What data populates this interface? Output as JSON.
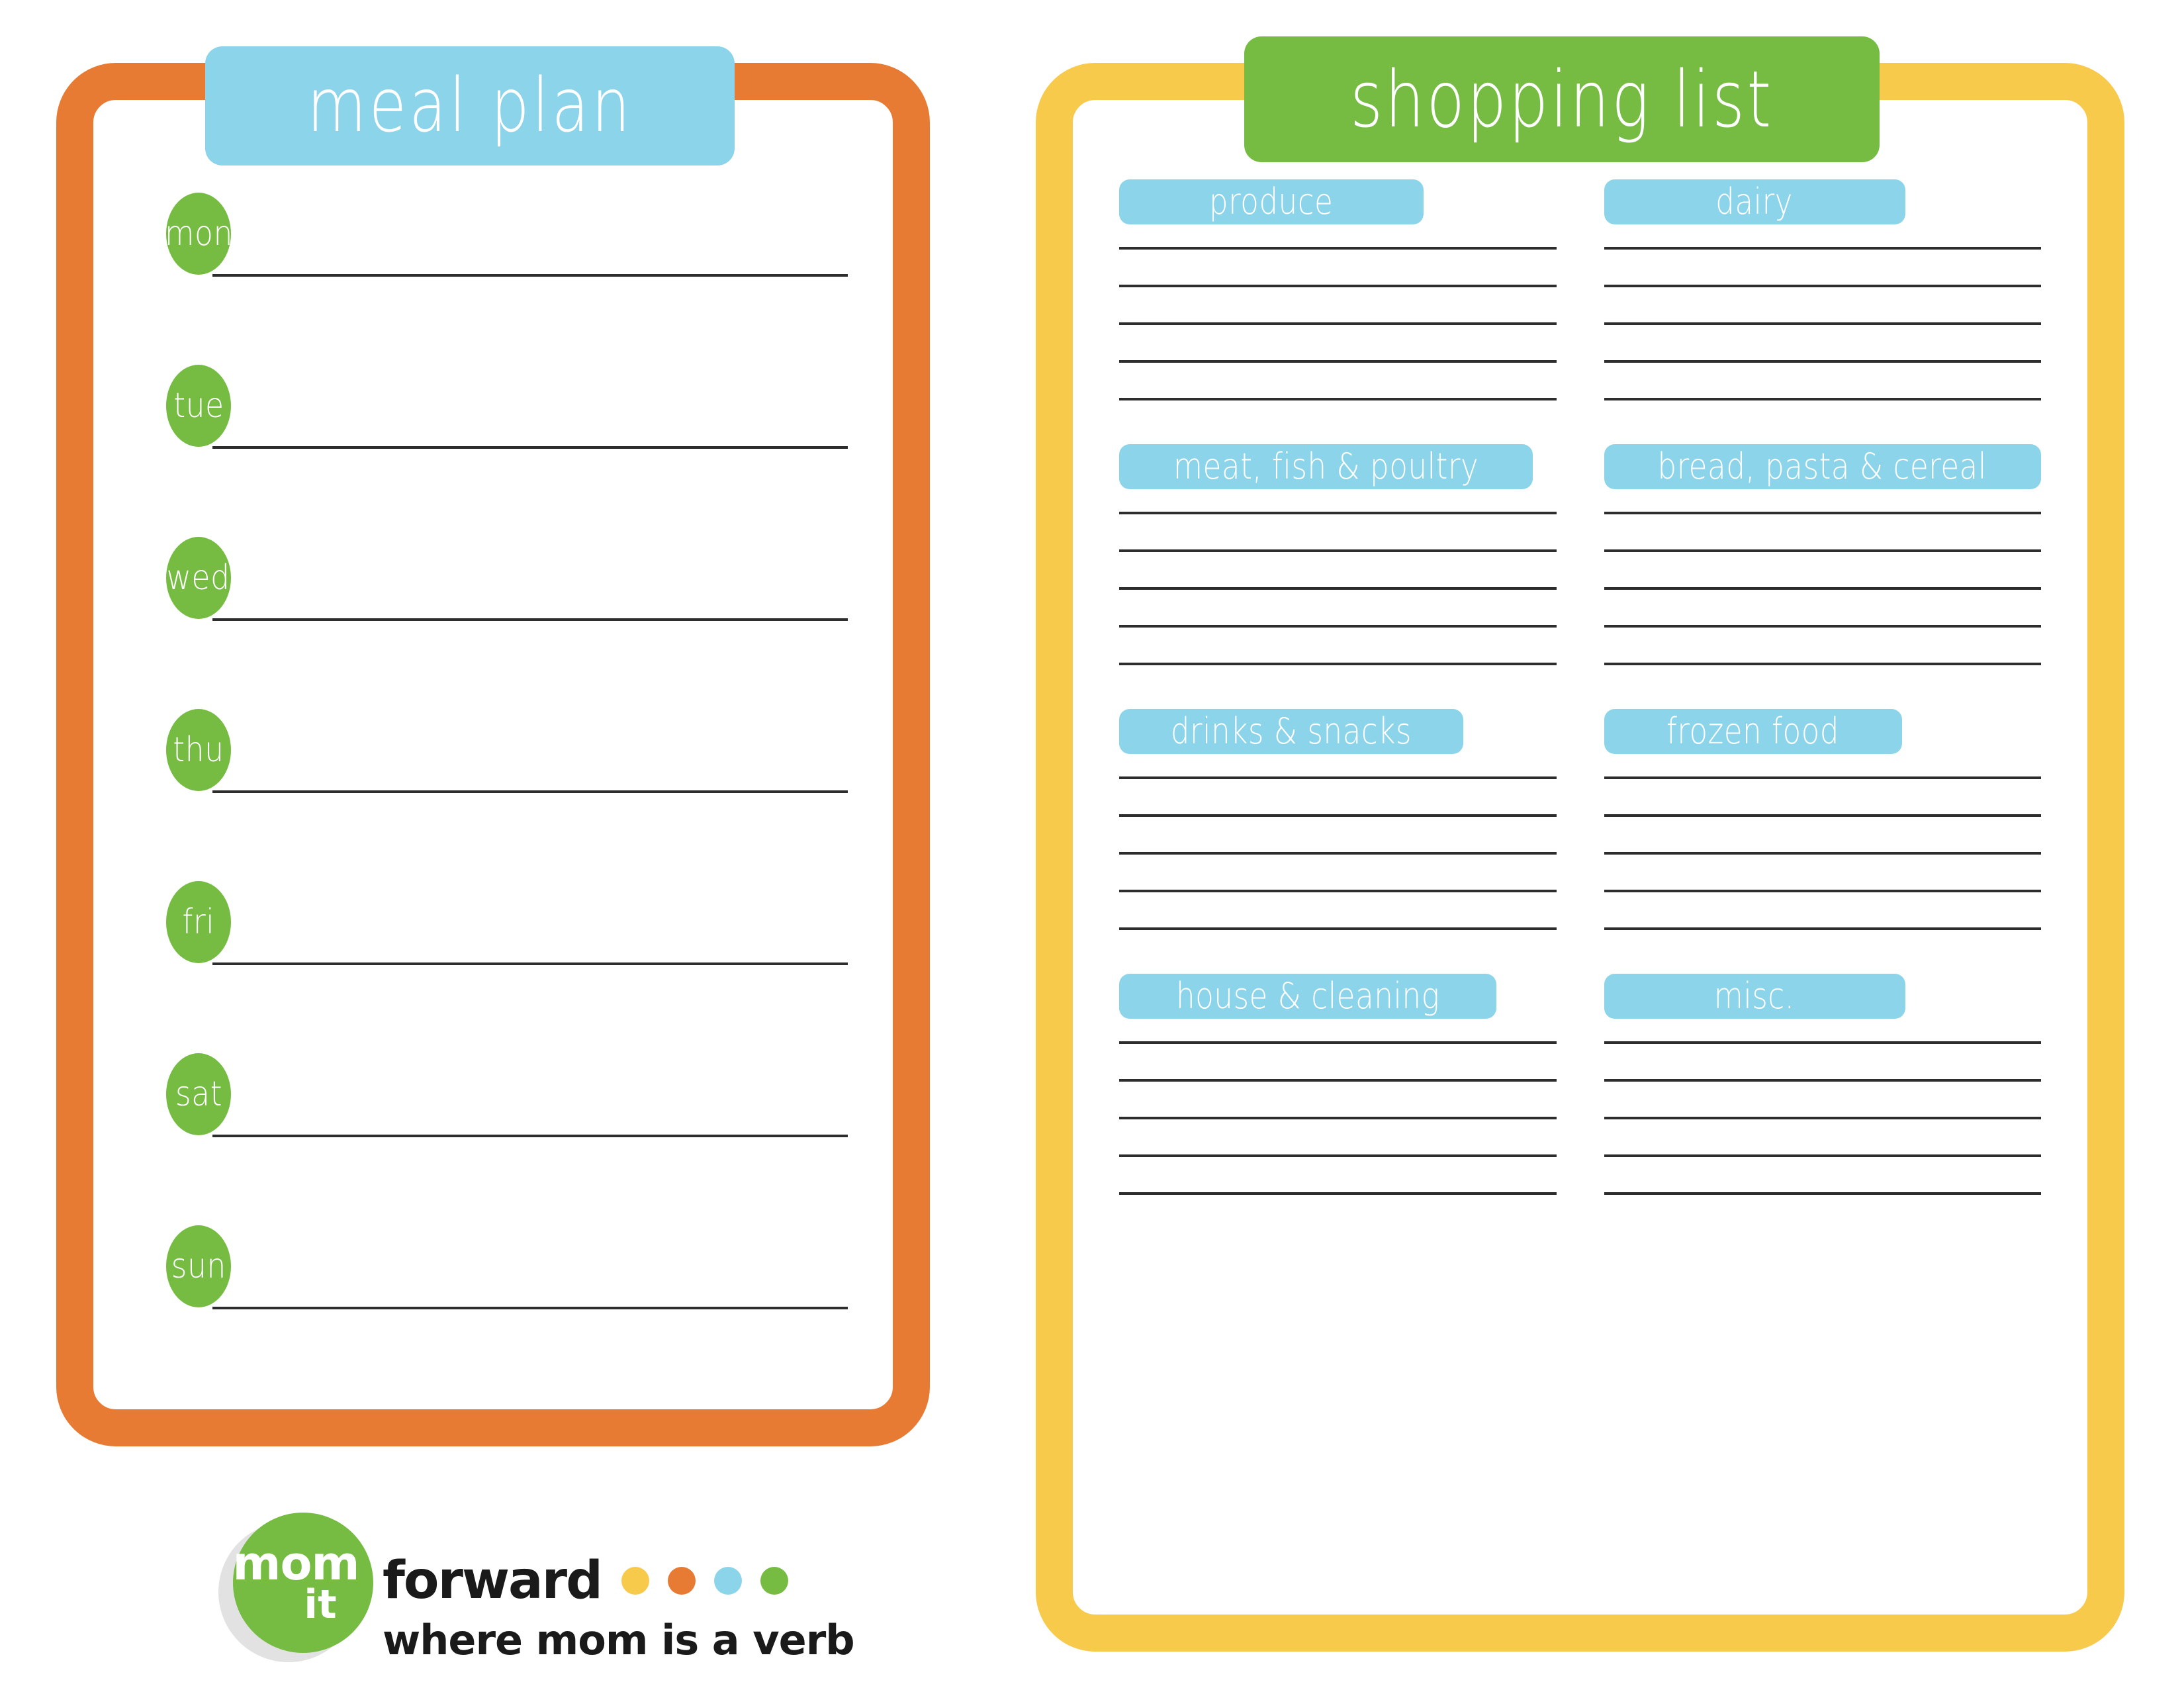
{
  "colors": {
    "orange": "#e87b33",
    "yellow": "#f7ca4c",
    "blue": "#8cd4ea",
    "green": "#76bc43",
    "line": "#2d2d2d",
    "white": "#ffffff",
    "black": "#1a1a1a",
    "gray_shadow": "#e2e2e2"
  },
  "meal_plan": {
    "title": "meal plan",
    "days": [
      {
        "label": "mon"
      },
      {
        "label": "tue"
      },
      {
        "label": "wed"
      },
      {
        "label": "thu"
      },
      {
        "label": "fri"
      },
      {
        "label": "sat"
      },
      {
        "label": "sun"
      }
    ]
  },
  "shopping_list": {
    "title": "shopping list",
    "categories": [
      {
        "label": "produce",
        "lines": 5,
        "tag_width_class": "tag-w-produce"
      },
      {
        "label": "dairy",
        "lines": 5,
        "tag_width_class": "tag-w-dairy"
      },
      {
        "label": "meat, fish & poultry",
        "lines": 5,
        "tag_width_class": "tag-w-meat"
      },
      {
        "label": "bread, pasta & cereal",
        "lines": 5,
        "tag_width_class": "tag-w-bread"
      },
      {
        "label": "drinks & snacks",
        "lines": 5,
        "tag_width_class": "tag-w-drinks"
      },
      {
        "label": "frozen food",
        "lines": 5,
        "tag_width_class": "tag-w-frozen"
      },
      {
        "label": "house & cleaning",
        "lines": 5,
        "tag_width_class": "tag-w-house"
      },
      {
        "label": "misc.",
        "lines": 5,
        "tag_width_class": "tag-w-misc"
      }
    ]
  },
  "logo": {
    "mom": "mom",
    "it": "it",
    "forward": "forward",
    "tagline": "where mom is a verb",
    "dots": [
      {
        "name": "logo-dot-yellow",
        "color": "#f7ca4c"
      },
      {
        "name": "logo-dot-orange",
        "color": "#e87b33"
      },
      {
        "name": "logo-dot-blue",
        "color": "#8cd4ea"
      },
      {
        "name": "logo-dot-green",
        "color": "#76bc43"
      }
    ]
  }
}
